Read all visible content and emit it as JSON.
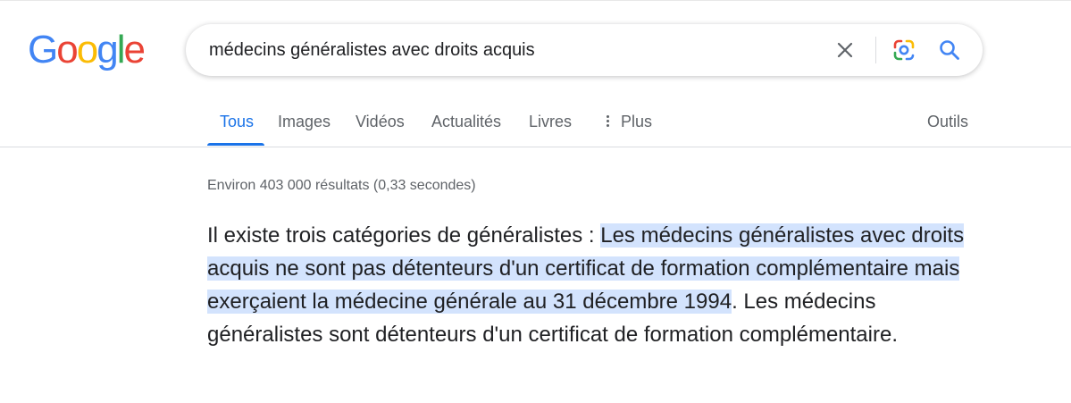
{
  "logo": {
    "letters": [
      "G",
      "o",
      "o",
      "g",
      "l",
      "e"
    ],
    "colors": [
      "#4285F4",
      "#EA4335",
      "#FBBC05",
      "#4285F4",
      "#34A853",
      "#EA4335"
    ]
  },
  "search": {
    "query": "médecins généralistes avec droits acquis",
    "clear_icon": "close-icon",
    "lens_icon": "google-lens-icon",
    "search_icon": "search-icon"
  },
  "tabs": {
    "items": [
      {
        "label": "Tous",
        "active": true
      },
      {
        "label": "Images",
        "active": false
      },
      {
        "label": "Vidéos",
        "active": false
      },
      {
        "label": "Actualités",
        "active": false
      },
      {
        "label": "Livres",
        "active": false
      },
      {
        "label": "Plus",
        "active": false
      }
    ],
    "tools_label": "Outils"
  },
  "results": {
    "stats": "Environ 403 000 résultats (0,33 secondes)",
    "snippet": {
      "before": "Il existe trois catégories de généralistes : ",
      "highlight": "Les médecins généralistes avec droits acquis ne sont pas détenteurs d'un certificat de formation complémentaire mais exerçaient la médecine générale au 31 décembre 1994",
      "after": ". Les médecins généralistes sont détenteurs d'un certificat de formation complémentaire."
    }
  },
  "colors": {
    "accent": "#1a73e8",
    "highlight": "#d3e3fd",
    "text": "#202124",
    "muted": "#5f6368"
  }
}
